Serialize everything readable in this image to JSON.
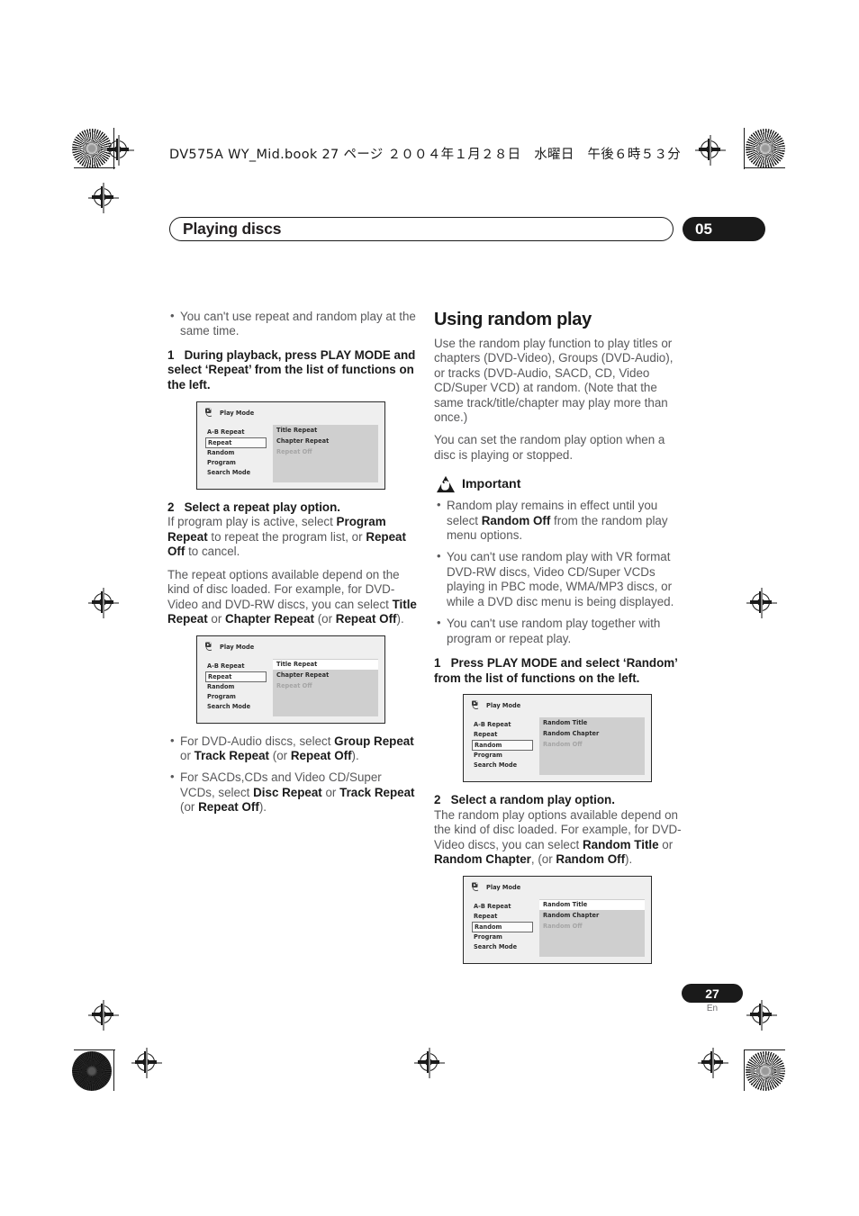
{
  "header": {
    "book_line": "DV575A WY_Mid.book  27 ページ  ２００４年１月２８日　水曜日　午後６時５３分"
  },
  "chapter": {
    "title": "Playing discs",
    "number": "05"
  },
  "footer": {
    "page_number": "27",
    "language": "En"
  },
  "left_column": {
    "top_bullets": [
      "You can't use repeat and random play at the same time."
    ],
    "step1": {
      "num": "1",
      "text": "During playback, press PLAY MODE and select ‘Repeat’ from the list of functions on the left."
    },
    "step2": {
      "num": "2",
      "head": "Select a repeat play option.",
      "body_a_1": "If program play is active, select ",
      "body_a_b1": "Program Repeat",
      "body_a_2": " to repeat the program list, or ",
      "body_a_b2": "Repeat Off",
      "body_a_3": " to cancel.",
      "body_b_1": "The repeat options available depend on the kind of disc loaded. For example, for DVD-Video and DVD-RW discs, you can select ",
      "body_b_b1": "Title Repeat",
      "body_b_2": " or ",
      "body_b_b2": "Chapter Repeat",
      "body_b_3": " (or ",
      "body_b_b3": "Repeat Off",
      "body_b_4": ")."
    },
    "bottom_bullets": [
      {
        "t1": "For DVD-Audio discs, select ",
        "b1": "Group Repeat",
        "t2": " or ",
        "b2": "Track Repeat",
        "t3": " (or ",
        "b3": "Repeat Off",
        "t4": ")."
      },
      {
        "t1": "For SACDs,CDs and Video CD/Super VCDs, select ",
        "b1": "Disc Repeat",
        "t2": " or ",
        "b2": "Track Repeat",
        "t3": " (or ",
        "b3": "Repeat Off",
        "t4": ")."
      }
    ]
  },
  "right_column": {
    "section_title": "Using random play",
    "intro_1": "Use the random play function to play titles or chapters (DVD-Video), Groups (DVD-Audio), or tracks (DVD-Audio, SACD, CD, Video CD/Super VCD) at random. (Note that the same track/title/chapter may play more than once.)",
    "intro_2": "You can set the random play option when a disc is playing or stopped.",
    "important": {
      "label": "Important",
      "bullets": [
        {
          "t1": "Random play remains in effect until you select ",
          "b1": "Random Off",
          "t2": " from the random play menu options."
        },
        {
          "t1": "You can't use random play with VR format DVD-RW discs, Video CD/Super VCDs playing in PBC mode, WMA/MP3 discs, or while a DVD disc menu is being displayed.",
          "b1": "",
          "t2": ""
        },
        {
          "t1": "You can't use random play together with program or repeat play.",
          "b1": "",
          "t2": ""
        }
      ]
    },
    "step1": {
      "num": "1",
      "text": "Press PLAY MODE and select ‘Random’ from the list of functions on the left."
    },
    "step2": {
      "num": "2",
      "head": "Select a random play option.",
      "body_1": "The random play options available depend on the kind of disc loaded. For example, for DVD-Video discs, you can select ",
      "body_b1": "Random Title",
      "body_2": " or ",
      "body_b2": "Random Chapter",
      "body_3": ", (or ",
      "body_b3": "Random Off",
      "body_4": ")."
    }
  },
  "osd_screens": {
    "title": "Play Mode",
    "menu_items": [
      "A-B Repeat",
      "Repeat",
      "Random",
      "Program",
      "Search Mode"
    ],
    "repeat_unselected": {
      "selected_menu": "Repeat",
      "options": [
        "Title Repeat",
        "Chapter Repeat",
        "Repeat Off"
      ],
      "dim_option": "Repeat Off",
      "highlighted_option": ""
    },
    "repeat_selected": {
      "selected_menu": "Repeat",
      "options": [
        "Title Repeat",
        "Chapter Repeat",
        "Repeat Off"
      ],
      "dim_option": "Repeat Off",
      "highlighted_option": "Title Repeat"
    },
    "random_unselected": {
      "selected_menu": "Random",
      "options": [
        "Random Title",
        "Random Chapter",
        "Random Off"
      ],
      "dim_option": "Random Off",
      "highlighted_option": ""
    },
    "random_selected": {
      "selected_menu": "Random",
      "options": [
        "Random Title",
        "Random Chapter",
        "Random Off"
      ],
      "dim_option": "Random Off",
      "highlighted_option": "Random Title"
    }
  },
  "colors": {
    "ink": "#1a1a1a",
    "body_text": "#58585a",
    "osd_bg": "#efefef",
    "osd_panel": "#cfcfcf"
  }
}
